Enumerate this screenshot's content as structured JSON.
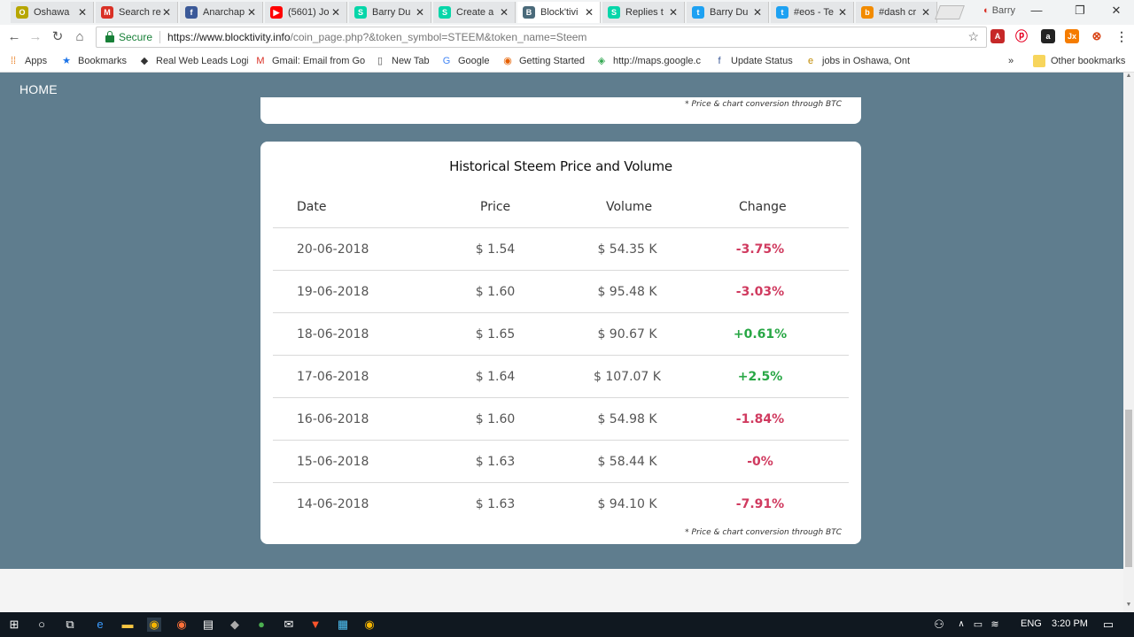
{
  "tabs": [
    {
      "title": "Oshawa",
      "icon": "oshawa-icon",
      "color": "#b7a600"
    },
    {
      "title": "Search re",
      "icon": "gmail-icon",
      "color": "#d93025"
    },
    {
      "title": "Anarchap",
      "icon": "facebook-icon",
      "color": "#3b5998"
    },
    {
      "title": "(5601) Jo",
      "icon": "youtube-icon",
      "color": "#ff0000"
    },
    {
      "title": "Barry Du",
      "icon": "steemit-icon",
      "color": "#06d6a9"
    },
    {
      "title": "Create a",
      "icon": "steemit-icon",
      "color": "#06d6a9"
    },
    {
      "title": "Block'tivi",
      "icon": "blocktivity-icon",
      "color": "#4a6a7a"
    },
    {
      "title": "Replies t",
      "icon": "steemit-icon",
      "color": "#06d6a9"
    },
    {
      "title": "Barry Du",
      "icon": "twitter-icon",
      "color": "#1da1f2"
    },
    {
      "title": "#eos - Te",
      "icon": "twitter-icon",
      "color": "#1da1f2"
    },
    {
      "title": "#dash cr",
      "icon": "brave-icon",
      "color": "#f28b00"
    }
  ],
  "profile_name": "Barry",
  "address": {
    "secure_label": "Secure",
    "url_host": "https://www.blocktivity.info",
    "url_rest": "/coin_page.php?&token_symbol=STEEM&token_name=Steem"
  },
  "bookmarks": {
    "items": [
      {
        "label": "Apps",
        "icon": "apps-grid-icon"
      },
      {
        "label": "Bookmarks",
        "icon": "star-icon"
      },
      {
        "label": "Real Web Leads Logi",
        "icon": "leads-icon"
      },
      {
        "label": "Gmail: Email from Go",
        "icon": "gmail-icon"
      },
      {
        "label": "New Tab",
        "icon": "page-icon"
      },
      {
        "label": "Google",
        "icon": "google-icon"
      },
      {
        "label": "Getting Started",
        "icon": "firefox-icon"
      },
      {
        "label": "http://maps.google.c",
        "icon": "maps-icon"
      },
      {
        "label": "Update Status",
        "icon": "facebook-icon"
      },
      {
        "label": "jobs in Oshawa, Ont",
        "icon": "ie-icon"
      }
    ],
    "overflow": "»",
    "other": "Other bookmarks"
  },
  "page": {
    "nav_home": "HOME",
    "footnote": "* Price & chart conversion through BTC",
    "table": {
      "title": "Historical Steem Price and Volume",
      "headers": [
        "Date",
        "Price",
        "Volume",
        "Change"
      ],
      "rows": [
        {
          "date": "20-06-2018",
          "price": "$ 1.54",
          "volume": "$ 54.35 K",
          "change": "-3.75%",
          "direction": "down"
        },
        {
          "date": "19-06-2018",
          "price": "$ 1.60",
          "volume": "$ 95.48 K",
          "change": "-3.03%",
          "direction": "down"
        },
        {
          "date": "18-06-2018",
          "price": "$ 1.65",
          "volume": "$ 90.67 K",
          "change": "+0.61%",
          "direction": "up"
        },
        {
          "date": "17-06-2018",
          "price": "$ 1.64",
          "volume": "$ 107.07 K",
          "change": "+2.5%",
          "direction": "up"
        },
        {
          "date": "16-06-2018",
          "price": "$ 1.60",
          "volume": "$ 54.98 K",
          "change": "-1.84%",
          "direction": "down"
        },
        {
          "date": "15-06-2018",
          "price": "$ 1.63",
          "volume": "$ 58.44 K",
          "change": "-0%",
          "direction": "down"
        },
        {
          "date": "14-06-2018",
          "price": "$ 1.63",
          "volume": "$ 94.10 K",
          "change": "-7.91%",
          "direction": "down"
        }
      ]
    }
  },
  "taskbar": {
    "lang": "ENG",
    "time": "3:20 PM"
  },
  "colors": {
    "page_bg": "#5f7d8e",
    "negative": "#d03a5f",
    "positive": "#28a745",
    "taskbar": "#101820"
  }
}
